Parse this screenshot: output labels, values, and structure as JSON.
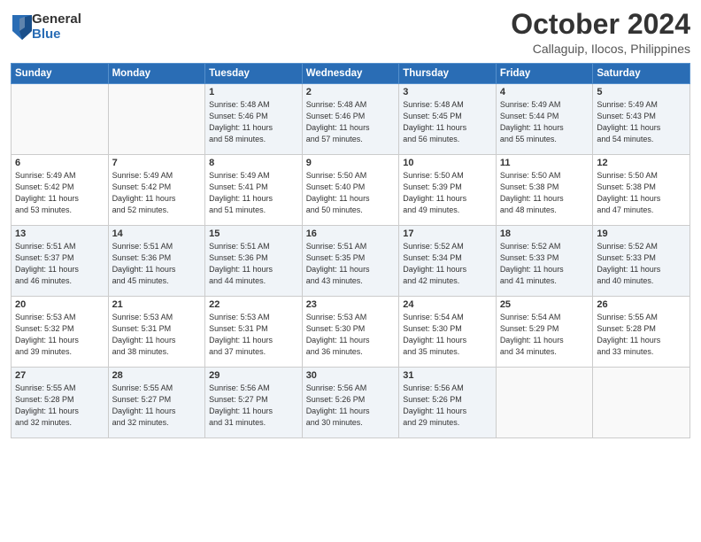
{
  "logo": {
    "general": "General",
    "blue": "Blue"
  },
  "header": {
    "month": "October 2024",
    "location": "Callaguip, Ilocos, Philippines"
  },
  "weekdays": [
    "Sunday",
    "Monday",
    "Tuesday",
    "Wednesday",
    "Thursday",
    "Friday",
    "Saturday"
  ],
  "weeks": [
    [
      {
        "day": "",
        "info": ""
      },
      {
        "day": "",
        "info": ""
      },
      {
        "day": "1",
        "info": "Sunrise: 5:48 AM\nSunset: 5:46 PM\nDaylight: 11 hours\nand 58 minutes."
      },
      {
        "day": "2",
        "info": "Sunrise: 5:48 AM\nSunset: 5:46 PM\nDaylight: 11 hours\nand 57 minutes."
      },
      {
        "day": "3",
        "info": "Sunrise: 5:48 AM\nSunset: 5:45 PM\nDaylight: 11 hours\nand 56 minutes."
      },
      {
        "day": "4",
        "info": "Sunrise: 5:49 AM\nSunset: 5:44 PM\nDaylight: 11 hours\nand 55 minutes."
      },
      {
        "day": "5",
        "info": "Sunrise: 5:49 AM\nSunset: 5:43 PM\nDaylight: 11 hours\nand 54 minutes."
      }
    ],
    [
      {
        "day": "6",
        "info": "Sunrise: 5:49 AM\nSunset: 5:42 PM\nDaylight: 11 hours\nand 53 minutes."
      },
      {
        "day": "7",
        "info": "Sunrise: 5:49 AM\nSunset: 5:42 PM\nDaylight: 11 hours\nand 52 minutes."
      },
      {
        "day": "8",
        "info": "Sunrise: 5:49 AM\nSunset: 5:41 PM\nDaylight: 11 hours\nand 51 minutes."
      },
      {
        "day": "9",
        "info": "Sunrise: 5:50 AM\nSunset: 5:40 PM\nDaylight: 11 hours\nand 50 minutes."
      },
      {
        "day": "10",
        "info": "Sunrise: 5:50 AM\nSunset: 5:39 PM\nDaylight: 11 hours\nand 49 minutes."
      },
      {
        "day": "11",
        "info": "Sunrise: 5:50 AM\nSunset: 5:38 PM\nDaylight: 11 hours\nand 48 minutes."
      },
      {
        "day": "12",
        "info": "Sunrise: 5:50 AM\nSunset: 5:38 PM\nDaylight: 11 hours\nand 47 minutes."
      }
    ],
    [
      {
        "day": "13",
        "info": "Sunrise: 5:51 AM\nSunset: 5:37 PM\nDaylight: 11 hours\nand 46 minutes."
      },
      {
        "day": "14",
        "info": "Sunrise: 5:51 AM\nSunset: 5:36 PM\nDaylight: 11 hours\nand 45 minutes."
      },
      {
        "day": "15",
        "info": "Sunrise: 5:51 AM\nSunset: 5:36 PM\nDaylight: 11 hours\nand 44 minutes."
      },
      {
        "day": "16",
        "info": "Sunrise: 5:51 AM\nSunset: 5:35 PM\nDaylight: 11 hours\nand 43 minutes."
      },
      {
        "day": "17",
        "info": "Sunrise: 5:52 AM\nSunset: 5:34 PM\nDaylight: 11 hours\nand 42 minutes."
      },
      {
        "day": "18",
        "info": "Sunrise: 5:52 AM\nSunset: 5:33 PM\nDaylight: 11 hours\nand 41 minutes."
      },
      {
        "day": "19",
        "info": "Sunrise: 5:52 AM\nSunset: 5:33 PM\nDaylight: 11 hours\nand 40 minutes."
      }
    ],
    [
      {
        "day": "20",
        "info": "Sunrise: 5:53 AM\nSunset: 5:32 PM\nDaylight: 11 hours\nand 39 minutes."
      },
      {
        "day": "21",
        "info": "Sunrise: 5:53 AM\nSunset: 5:31 PM\nDaylight: 11 hours\nand 38 minutes."
      },
      {
        "day": "22",
        "info": "Sunrise: 5:53 AM\nSunset: 5:31 PM\nDaylight: 11 hours\nand 37 minutes."
      },
      {
        "day": "23",
        "info": "Sunrise: 5:53 AM\nSunset: 5:30 PM\nDaylight: 11 hours\nand 36 minutes."
      },
      {
        "day": "24",
        "info": "Sunrise: 5:54 AM\nSunset: 5:30 PM\nDaylight: 11 hours\nand 35 minutes."
      },
      {
        "day": "25",
        "info": "Sunrise: 5:54 AM\nSunset: 5:29 PM\nDaylight: 11 hours\nand 34 minutes."
      },
      {
        "day": "26",
        "info": "Sunrise: 5:55 AM\nSunset: 5:28 PM\nDaylight: 11 hours\nand 33 minutes."
      }
    ],
    [
      {
        "day": "27",
        "info": "Sunrise: 5:55 AM\nSunset: 5:28 PM\nDaylight: 11 hours\nand 32 minutes."
      },
      {
        "day": "28",
        "info": "Sunrise: 5:55 AM\nSunset: 5:27 PM\nDaylight: 11 hours\nand 32 minutes."
      },
      {
        "day": "29",
        "info": "Sunrise: 5:56 AM\nSunset: 5:27 PM\nDaylight: 11 hours\nand 31 minutes."
      },
      {
        "day": "30",
        "info": "Sunrise: 5:56 AM\nSunset: 5:26 PM\nDaylight: 11 hours\nand 30 minutes."
      },
      {
        "day": "31",
        "info": "Sunrise: 5:56 AM\nSunset: 5:26 PM\nDaylight: 11 hours\nand 29 minutes."
      },
      {
        "day": "",
        "info": ""
      },
      {
        "day": "",
        "info": ""
      }
    ]
  ]
}
